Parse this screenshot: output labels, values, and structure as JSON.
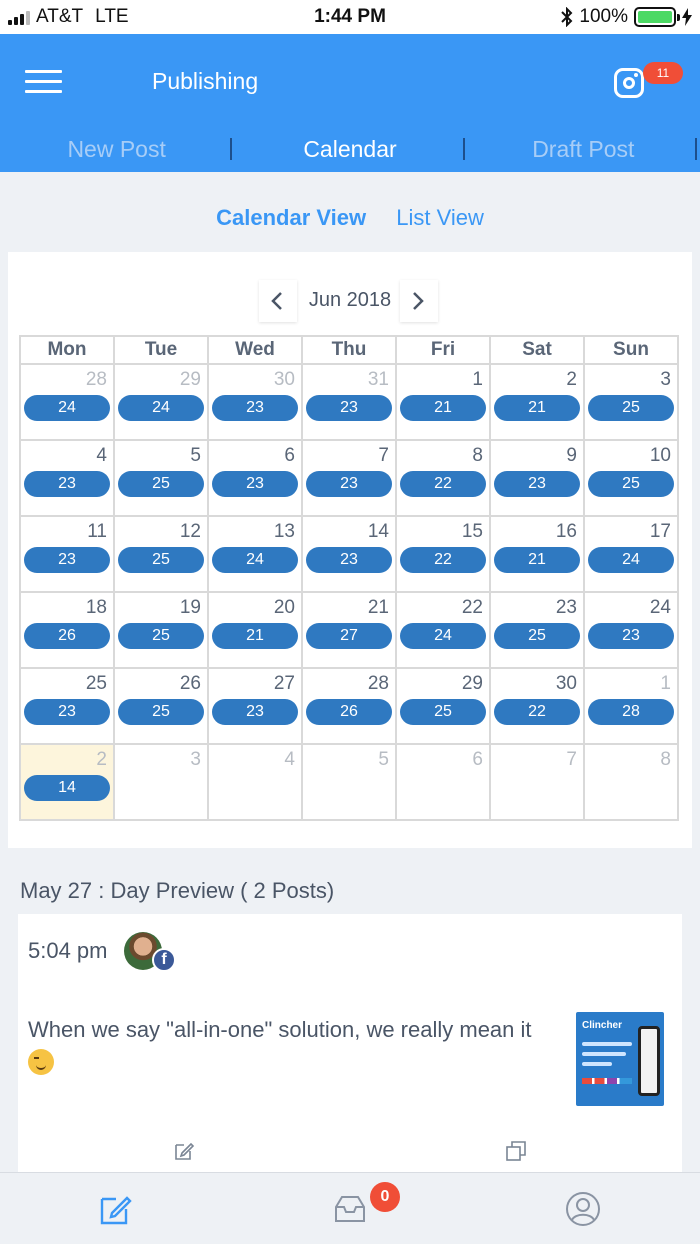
{
  "status": {
    "carrier": "AT&T",
    "network": "LTE",
    "time": "1:44 PM",
    "battery": "100%",
    "battery_level": 1.0
  },
  "header": {
    "title": "Publishing",
    "notification_count": "11",
    "tabs": [
      {
        "label": "New Post",
        "active": false
      },
      {
        "label": "Calendar",
        "active": true
      },
      {
        "label": "Draft Post",
        "active": false
      }
    ]
  },
  "view_toggle": {
    "calendar": "Calendar View",
    "list": "List View",
    "active": "calendar"
  },
  "calendar": {
    "month": "Jun 2018",
    "weekdays": [
      "Mon",
      "Tue",
      "Wed",
      "Thu",
      "Fri",
      "Sat",
      "Sun"
    ],
    "weeks": [
      [
        {
          "day": "28",
          "count": "24",
          "dim": true
        },
        {
          "day": "29",
          "count": "24",
          "dim": true
        },
        {
          "day": "30",
          "count": "23",
          "dim": true
        },
        {
          "day": "31",
          "count": "23",
          "dim": true
        },
        {
          "day": "1",
          "count": "21"
        },
        {
          "day": "2",
          "count": "21"
        },
        {
          "day": "3",
          "count": "25"
        }
      ],
      [
        {
          "day": "4",
          "count": "23"
        },
        {
          "day": "5",
          "count": "25"
        },
        {
          "day": "6",
          "count": "23"
        },
        {
          "day": "7",
          "count": "23"
        },
        {
          "day": "8",
          "count": "22"
        },
        {
          "day": "9",
          "count": "23"
        },
        {
          "day": "10",
          "count": "25"
        }
      ],
      [
        {
          "day": "11",
          "count": "23"
        },
        {
          "day": "12",
          "count": "25"
        },
        {
          "day": "13",
          "count": "24"
        },
        {
          "day": "14",
          "count": "23"
        },
        {
          "day": "15",
          "count": "22"
        },
        {
          "day": "16",
          "count": "21"
        },
        {
          "day": "17",
          "count": "24"
        }
      ],
      [
        {
          "day": "18",
          "count": "26"
        },
        {
          "day": "19",
          "count": "25"
        },
        {
          "day": "20",
          "count": "21"
        },
        {
          "day": "21",
          "count": "27"
        },
        {
          "day": "22",
          "count": "24"
        },
        {
          "day": "23",
          "count": "25"
        },
        {
          "day": "24",
          "count": "23"
        }
      ],
      [
        {
          "day": "25",
          "count": "23"
        },
        {
          "day": "26",
          "count": "25"
        },
        {
          "day": "27",
          "count": "23"
        },
        {
          "day": "28",
          "count": "26"
        },
        {
          "day": "29",
          "count": "25"
        },
        {
          "day": "30",
          "count": "22"
        },
        {
          "day": "1",
          "count": "28",
          "dim": true
        }
      ],
      [
        {
          "day": "2",
          "count": "14",
          "dim": true,
          "today": true
        },
        {
          "day": "3",
          "dim": true
        },
        {
          "day": "4",
          "dim": true
        },
        {
          "day": "5",
          "dim": true
        },
        {
          "day": "6",
          "dim": true
        },
        {
          "day": "7",
          "dim": true
        },
        {
          "day": "8",
          "dim": true
        }
      ]
    ]
  },
  "preview": {
    "title": "May 27 : Day Preview ( 2 Posts)",
    "post": {
      "time": "5:04 pm",
      "network": "facebook",
      "text": "When we say \"all-in-one\" solution, we really mean it",
      "thumbnail_brand": "Clincher"
    }
  },
  "bottom_bar": {
    "inbox_count": "0"
  },
  "colors": {
    "primary": "#3a97f5",
    "pill": "#2f79c1",
    "badge": "#f04e37",
    "today": "#fdf5dc"
  }
}
